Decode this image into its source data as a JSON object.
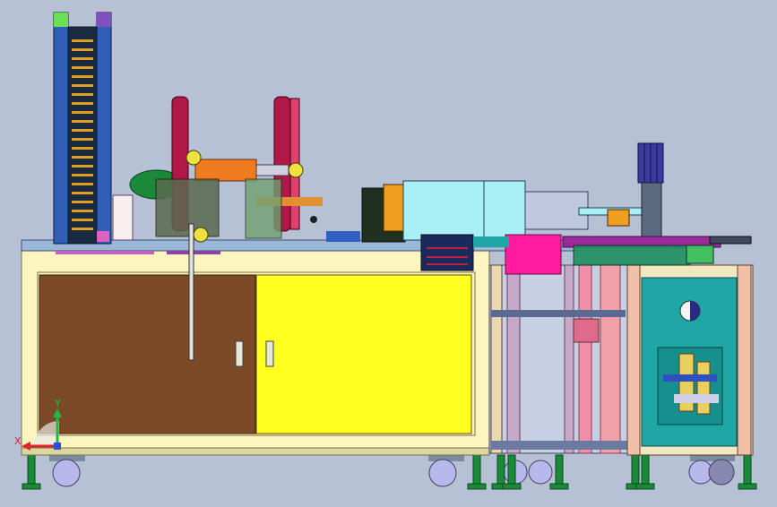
{
  "viewport": {
    "background": "#b7c1d6",
    "description_visible_text": ""
  },
  "triad": {
    "x_label": "X",
    "y_label": "Y",
    "x_color": "#e0222a",
    "y_color": "#22b845",
    "z_color": "#2c4fd8"
  },
  "colors": {
    "frame": "#fdf5c0",
    "frame_edge": "#7a7040",
    "door_brown": "#7c4a26",
    "door_yellow": "#ffff20",
    "cabinet_teal": "#1ea7a5",
    "tower_blue": "#2f5fb8",
    "tower_ladder": "#e0a020",
    "reel_red": "#b01848",
    "cyan_box": "#a8f0f5",
    "magenta": "#ff1aa0",
    "purple_rod": "#9a2a9a",
    "navy_panel": "#1a2a5a",
    "caster": "#b8b8ec",
    "foot_green": "#1a8a3a"
  }
}
